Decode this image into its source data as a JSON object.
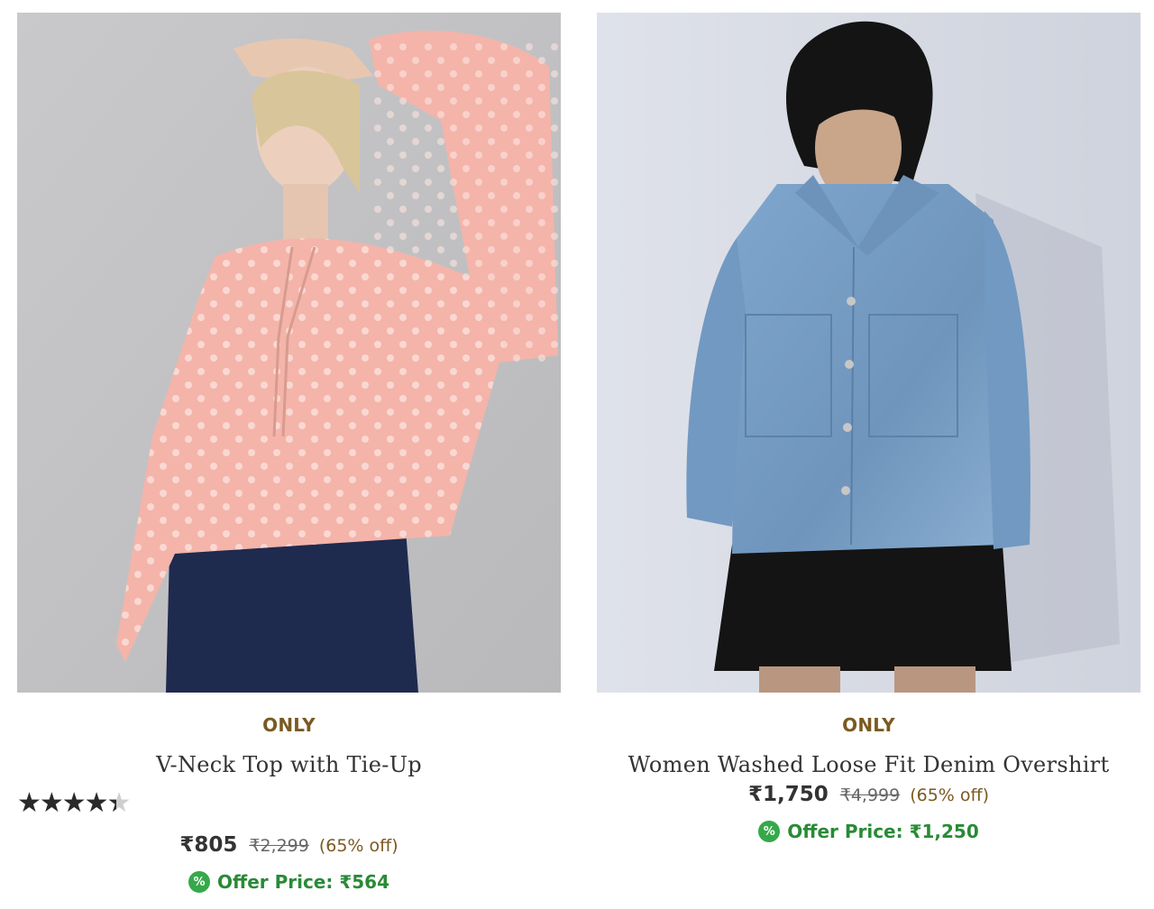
{
  "products": [
    {
      "brand": "ONLY",
      "title": "V-Neck Top with Tie-Up",
      "rating_fraction": 0.88,
      "price": "₹805",
      "mrp": "₹2,299",
      "discount": "(65% off)",
      "offer_label": "Offer Price: ₹564",
      "offer_icon": "%",
      "image_alt": "pink-top-photo"
    },
    {
      "brand": "ONLY",
      "title": "Women Washed Loose Fit Denim Overshirt",
      "price": "₹1,750",
      "mrp": "₹4,999",
      "discount": "(65% off)",
      "offer_label": "Offer Price: ₹1,250",
      "offer_icon": "%",
      "image_alt": "denim-overshirt-photo"
    }
  ],
  "colors": {
    "brand": "#7a5a21",
    "offer": "#2a8a37",
    "offer_icon_bg": "#35a94a"
  }
}
